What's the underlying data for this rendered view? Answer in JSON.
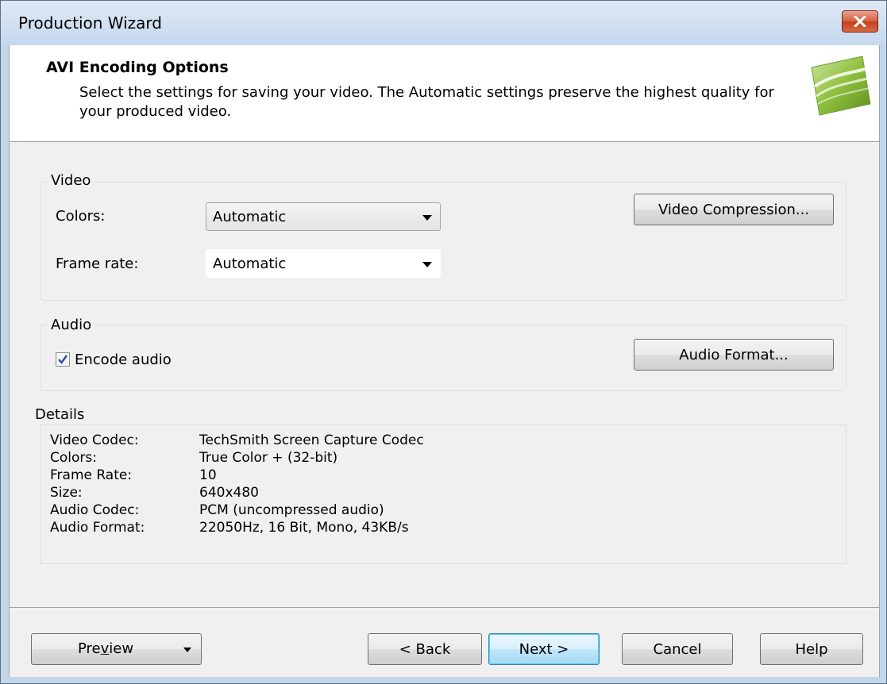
{
  "window": {
    "title": "Production Wizard"
  },
  "header": {
    "title": "AVI Encoding Options",
    "description": "Select the settings for saving your video.  The Automatic settings preserve the highest quality for your produced video.",
    "icon": "wizard-banner-icon"
  },
  "video": {
    "group_label": "Video",
    "colors_label": "Colors:",
    "colors_value": "Automatic",
    "frame_rate_label": "Frame rate:",
    "frame_rate_value": "Automatic",
    "compression_button": "Video Compression..."
  },
  "audio": {
    "group_label": "Audio",
    "encode_label": "Encode audio",
    "encode_checked": true,
    "format_button": "Audio Format..."
  },
  "details": {
    "label": "Details",
    "rows": [
      {
        "key": "Video Codec:",
        "value": "TechSmith Screen Capture Codec"
      },
      {
        "key": "Colors:",
        "value": "True Color + (32-bit)"
      },
      {
        "key": "Frame Rate:",
        "value": "10"
      },
      {
        "key": "Size:",
        "value": "640x480"
      },
      {
        "key": "Audio Codec:",
        "value": "PCM (uncompressed audio)"
      },
      {
        "key": "Audio Format:",
        "value": "22050Hz, 16 Bit, Mono, 43KB/s"
      }
    ]
  },
  "footer": {
    "preview_prefix": "Pre",
    "preview_mnemonic": "v",
    "preview_suffix": "iew",
    "back": "< Back",
    "next": "Next >",
    "cancel": "Cancel",
    "help": "Help"
  },
  "colors": {
    "title_bar": "#c5d8ee",
    "close_button": "#c2401e",
    "default_button_border": "#3c7fb1"
  }
}
